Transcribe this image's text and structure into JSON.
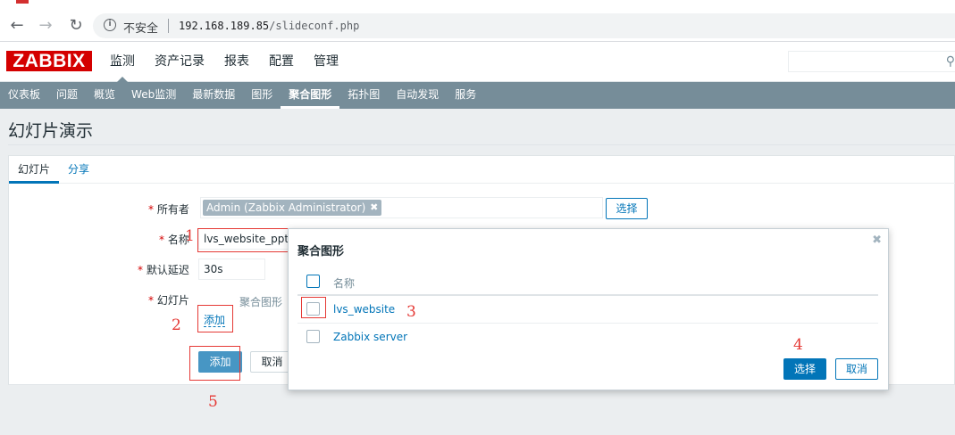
{
  "browser": {
    "back_icon": "arrow-left-icon",
    "forward_icon": "arrow-right-icon",
    "reload_icon": "reload-icon",
    "security_label": "不安全",
    "url_host": "192.168.189.85",
    "url_path": "/slideconf.php"
  },
  "header": {
    "logo": "ZABBIX",
    "main_menu": [
      "监测",
      "资产记录",
      "报表",
      "配置",
      "管理"
    ],
    "active_main_menu": "监测"
  },
  "sub_menu": {
    "items": [
      "仪表板",
      "问题",
      "概览",
      "Web监测",
      "最新数据",
      "图形",
      "聚合图形",
      "拓扑图",
      "自动发现",
      "服务"
    ],
    "active": "聚合图形"
  },
  "page": {
    "title": "幻灯片演示"
  },
  "form": {
    "tabs": [
      "幻灯片",
      "分享"
    ],
    "owner_label": "所有者",
    "owner_value": "Admin (Zabbix Administrator)",
    "owner_select_label": "选择",
    "name_label": "名称",
    "name_value": "lvs_website_ppt",
    "delay_label": "默认延迟",
    "delay_value": "30s",
    "slides_label": "幻灯片",
    "slides_column_header": "聚合图形",
    "add_slide_link": "添加",
    "submit_label": "添加",
    "cancel_label": "取消",
    "required_mark": "*"
  },
  "modal": {
    "title": "聚合图形",
    "column_name": "名称",
    "rows": [
      "lvs_website",
      "Zabbix server"
    ],
    "select_label": "选择",
    "cancel_label": "取消"
  },
  "annotations": [
    "1",
    "2",
    "3",
    "4",
    "5"
  ],
  "colors": {
    "brand": "#d40000",
    "accent": "#0275b8",
    "submenu_bg": "#768d99",
    "annotation": "#e53935"
  }
}
